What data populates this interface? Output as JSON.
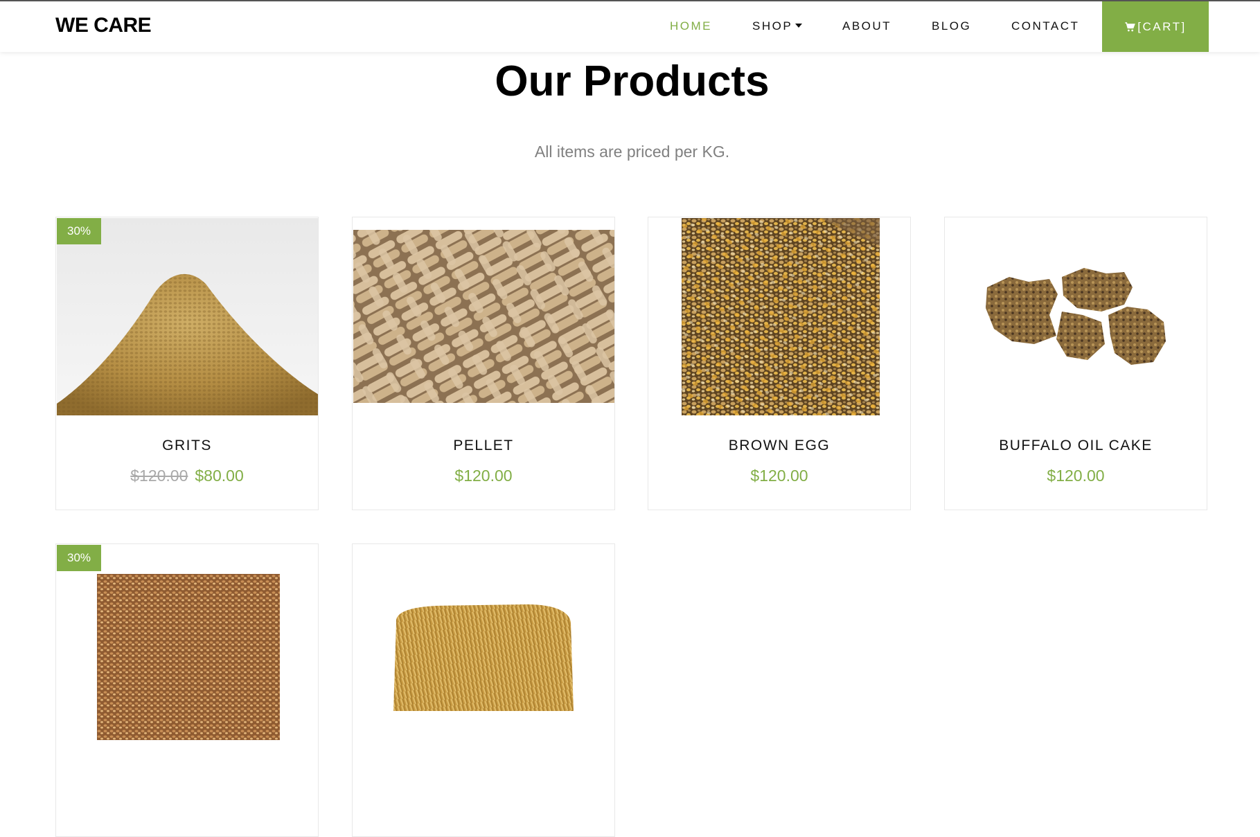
{
  "brand": "WE CARE",
  "nav": {
    "items": [
      {
        "label": "HOME",
        "active": true
      },
      {
        "label": "SHOP",
        "active": false
      },
      {
        "label": "ABOUT",
        "active": false
      },
      {
        "label": "BLOG",
        "active": false
      },
      {
        "label": "CONTACT",
        "active": false
      }
    ],
    "cart_label": "[CART]",
    "cart_icon": "cart-icon"
  },
  "section": {
    "title": "Our Products",
    "subtitle": "All items are priced per KG."
  },
  "products": [
    {
      "name": "GRITS",
      "badge": "30%",
      "old_price": "$120.00",
      "price": "$80.00",
      "image": "feed-pellet-pile"
    },
    {
      "name": "PELLET",
      "price": "$120.00",
      "image": "feed-pellet-sticks"
    },
    {
      "name": "BROWN EGG",
      "price": "$120.00",
      "image": "mixed-grain-feed"
    },
    {
      "name": "BUFFALO OIL CAKE",
      "price": "$120.00",
      "image": "oil-cake-pieces"
    },
    {
      "badge": "30%",
      "image": "crushed-grain"
    },
    {
      "image": "hay-bale"
    }
  ],
  "colors": {
    "accent": "#82ae46",
    "strikethrough": "#a9a9a9",
    "subtitle": "#808080"
  }
}
